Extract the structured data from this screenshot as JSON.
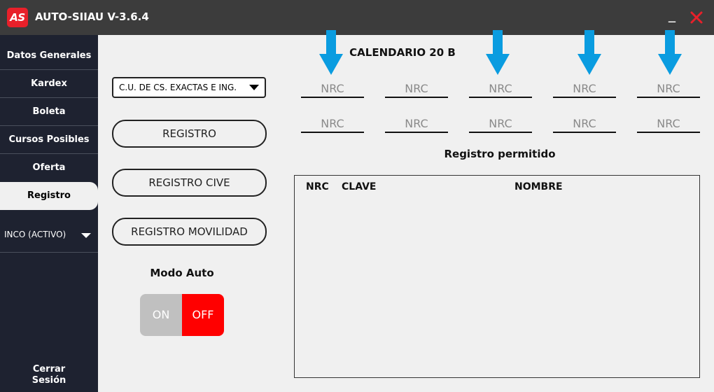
{
  "window": {
    "logo_text": "AS",
    "title": "AUTO-SIIAU V-3.6.4",
    "minimize_label": "_"
  },
  "colors": {
    "titlebar": "#3c3c3c",
    "sidebar": "#1e2230",
    "accent_red": "#e8202a",
    "arrow_blue": "#0a9ce0",
    "toggle_off": "#ff0000",
    "toggle_on_bg": "#c0c0c0"
  },
  "sidebar": {
    "items": [
      {
        "label": "Datos Generales"
      },
      {
        "label": "Kardex"
      },
      {
        "label": "Boleta"
      },
      {
        "label": "Cursos Posibles"
      },
      {
        "label": "Oferta"
      },
      {
        "label": "Registro",
        "active": true
      }
    ],
    "term_select": "INCO (ACTIVO)",
    "logout_line1": "Cerrar",
    "logout_line2": "Sesión"
  },
  "left_panel": {
    "campus_select": "C.U. DE CS. EXACTAS E ING.",
    "btn_registro": "REGISTRO",
    "btn_registro_cive": "REGISTRO CIVE",
    "btn_registro_movilidad": "REGISTRO MOVILIDAD",
    "modo_auto_label": "Modo Auto",
    "toggle": {
      "on_label": "ON",
      "off_label": "OFF",
      "state": "OFF"
    }
  },
  "calendar": {
    "title": "CALENDARIO 20 B",
    "arrow_icon": "down-arrow-icon",
    "nrc_placeholder": "NRC",
    "row1": [
      "",
      "",
      "",
      "",
      ""
    ],
    "row2": [
      "",
      "",
      "",
      "",
      ""
    ]
  },
  "registro_permitido": {
    "title": "Registro permitido",
    "columns": [
      "NRC",
      "CLAVE",
      "NOMBRE"
    ],
    "rows": []
  }
}
